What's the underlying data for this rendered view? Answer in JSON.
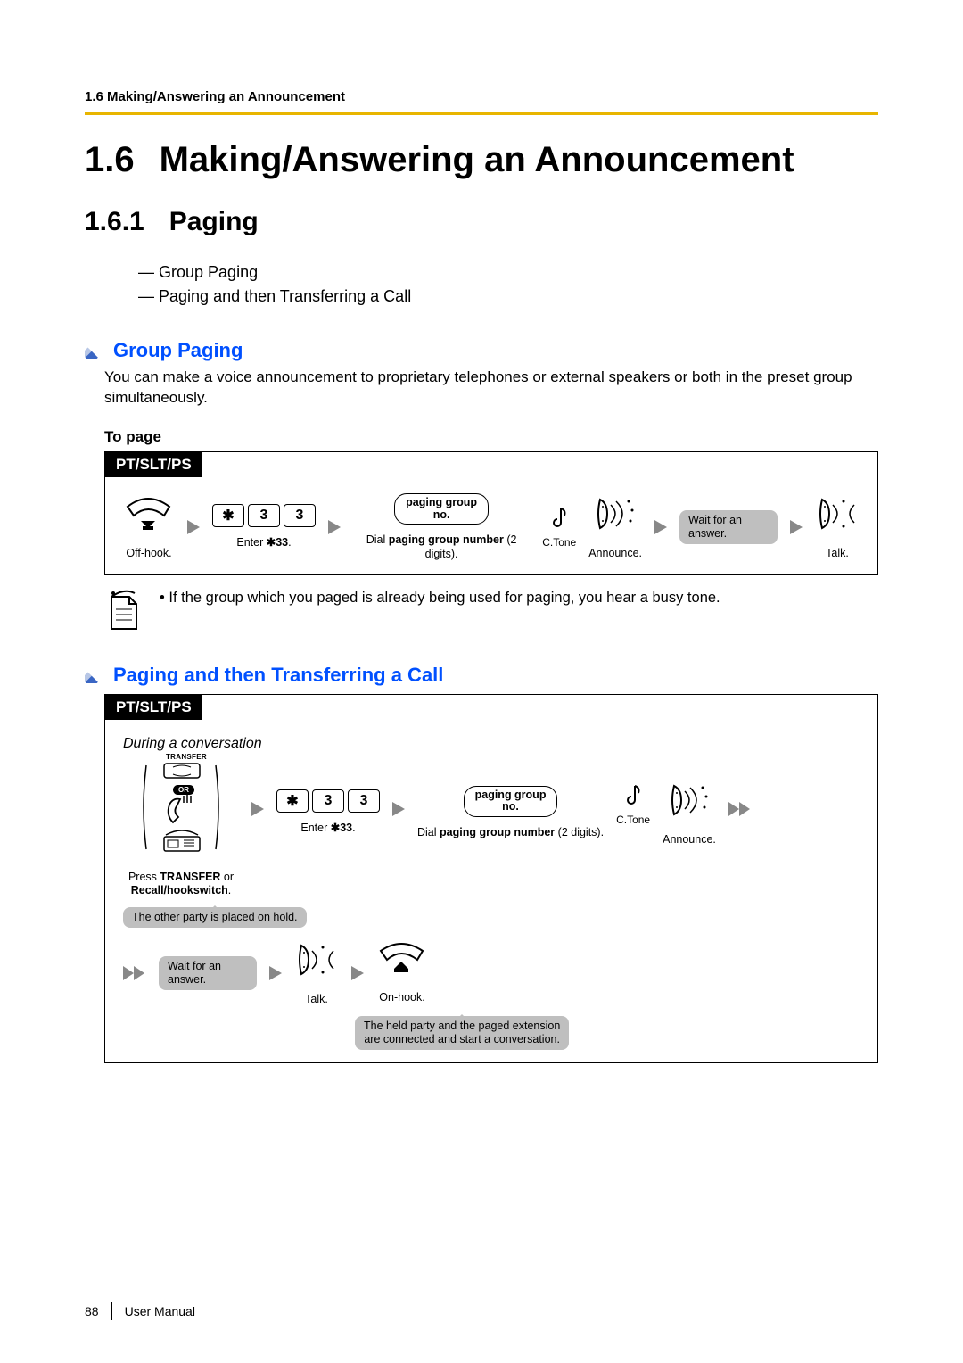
{
  "running_head": "1.6 Making/Answering an Announcement",
  "h1": {
    "num": "1.6",
    "text": "Making/Answering an Announcement"
  },
  "h2": {
    "num": "1.6.1",
    "text": "Paging"
  },
  "dashlist": [
    "Group Paging",
    "Paging and then Transferring a Call"
  ],
  "secA": {
    "title": "Group Paging",
    "body": "You can make a voice announcement to proprietary telephones or external speakers or both in the preset group simultaneously.",
    "subhead": "To page",
    "tab": "PT/SLT/PS",
    "keys": [
      "✱",
      "3",
      "3"
    ],
    "steps": {
      "offhook": "Off-hook.",
      "enter_pre": "Enter ",
      "enter_code": "✱33",
      "enter_post": ".",
      "pill_l1": "paging group",
      "pill_l2": "no.",
      "dial_pre": "Dial ",
      "dial_b": "paging group number",
      "dial_post": " (2 digits).",
      "ctone": "C.Tone",
      "announce": "Announce.",
      "wait": "Wait for an answer.",
      "talk": "Talk."
    },
    "note": "If the group which you paged is already being used for paging, you hear a busy tone."
  },
  "secB": {
    "title": "Paging and then Transferring a Call",
    "tab": "PT/SLT/PS",
    "context": "During a conversation",
    "transfer_label": "TRANSFER",
    "or_label": "OR",
    "keys": [
      "✱",
      "3",
      "3"
    ],
    "steps": {
      "press_pre": "Press ",
      "press_b1": "TRANSFER",
      "press_mid": " or ",
      "press_b2": "Recall/hookswitch",
      "press_post": ".",
      "hold_bubble": "The other party is placed on hold.",
      "enter_pre": "Enter ",
      "enter_code": "✱33",
      "enter_post": ".",
      "pill_l1": "paging group",
      "pill_l2": "no.",
      "dial_pre": "Dial ",
      "dial_b": "paging group number",
      "dial_post": " (2 digits).",
      "ctone": "C.Tone",
      "announce": "Announce.",
      "wait": "Wait for an answer.",
      "talk": "Talk.",
      "onhook": "On-hook.",
      "connect_bubble_l1": "The held party and the paged extension",
      "connect_bubble_l2": "are connected and start a conversation."
    }
  },
  "footer": {
    "page": "88",
    "label": "User Manual"
  }
}
